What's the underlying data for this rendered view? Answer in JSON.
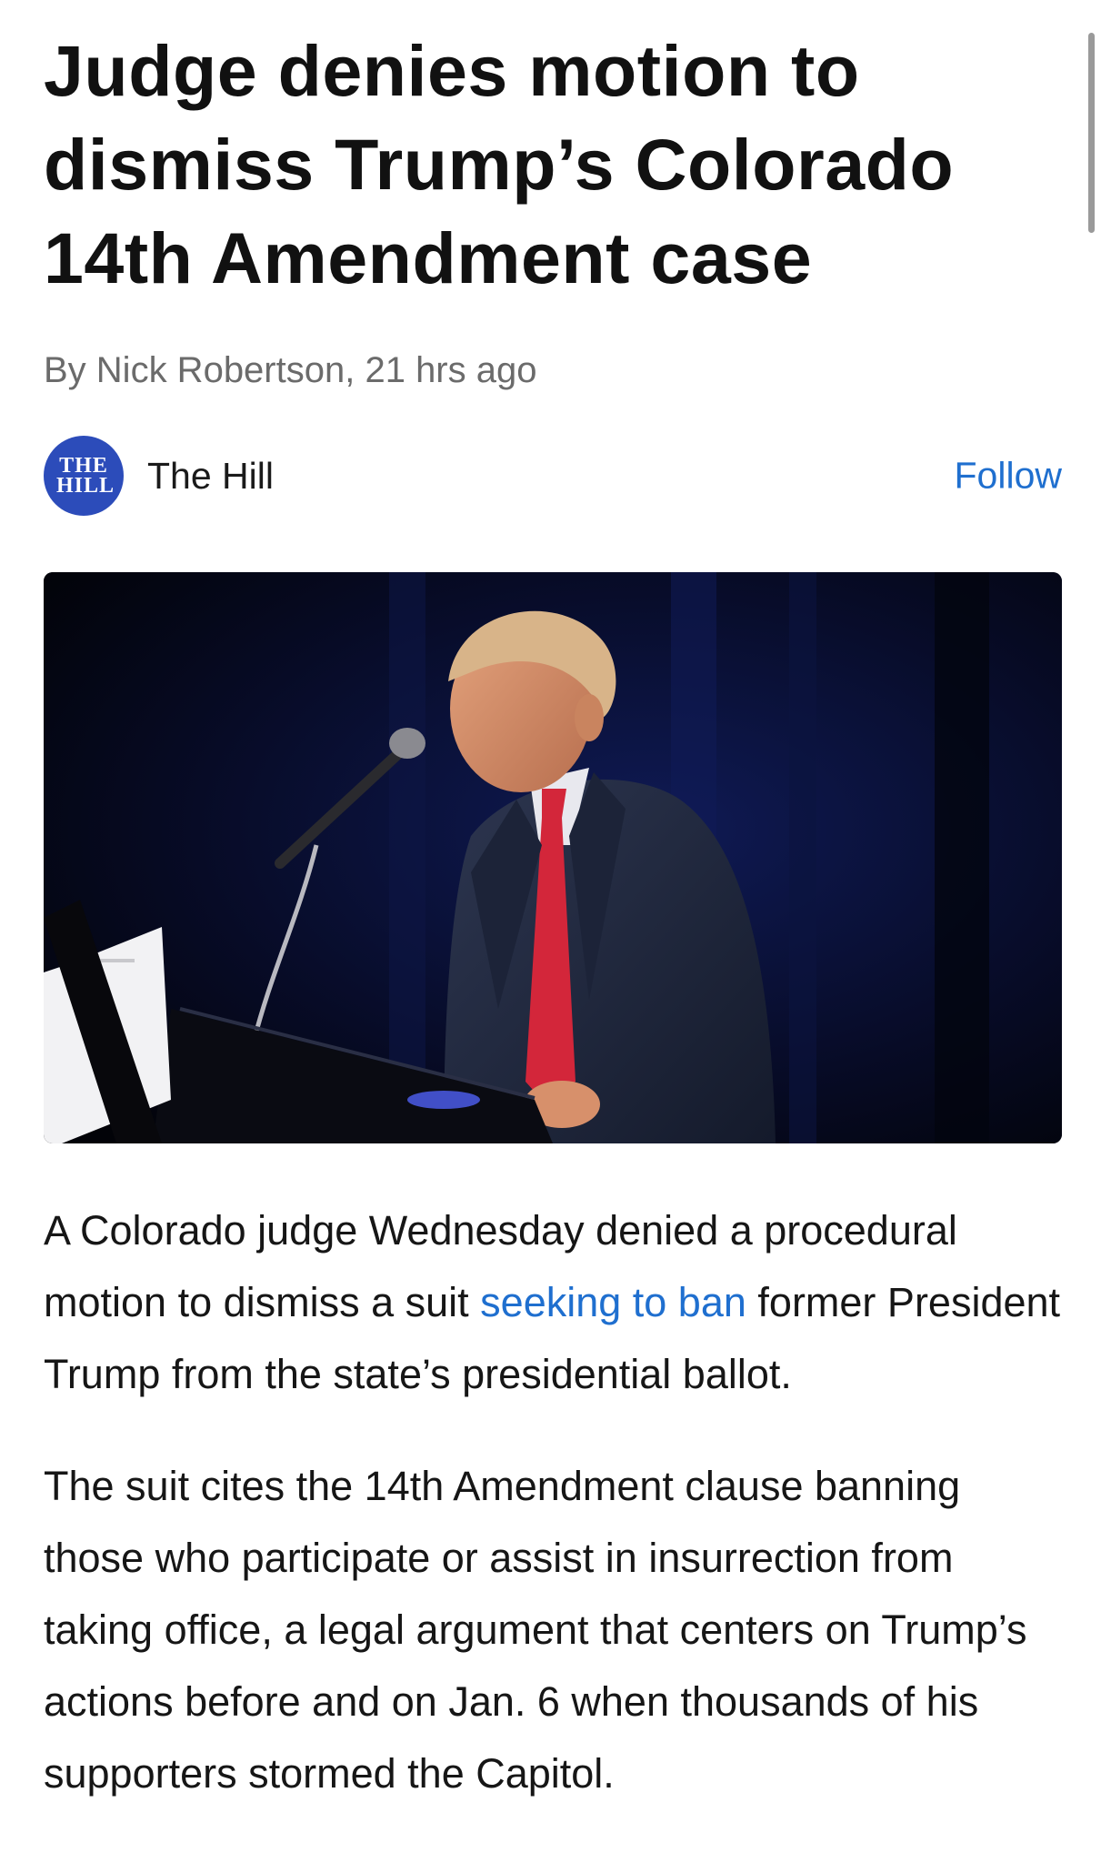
{
  "article": {
    "headline": "Judge denies motion to dismiss Trump’s Colorado 14th Amendment case",
    "byline": "By Nick Robertson, 21 hrs ago"
  },
  "source": {
    "logo_line1": "THE",
    "logo_line2": "HILL",
    "name": "The Hill",
    "follow_label": "Follow",
    "logo_color": "#2c4cba",
    "link_color": "#1f6fcf"
  },
  "photo": {
    "icon": "news-photo"
  },
  "body": {
    "p1_before": "A Colorado judge Wednesday denied a procedural motion to dismiss a suit ",
    "p1_link": "seeking to ban",
    "p1_after": " former President Trump from the state’s presidential ballot.",
    "p2": "The suit cites the 14th Amendment clause banning those who participate or assist in insurrection from taking office, a legal argument that centers on Trump’s actions before and on Jan. 6 when thousands of his supporters stormed the Capitol."
  }
}
